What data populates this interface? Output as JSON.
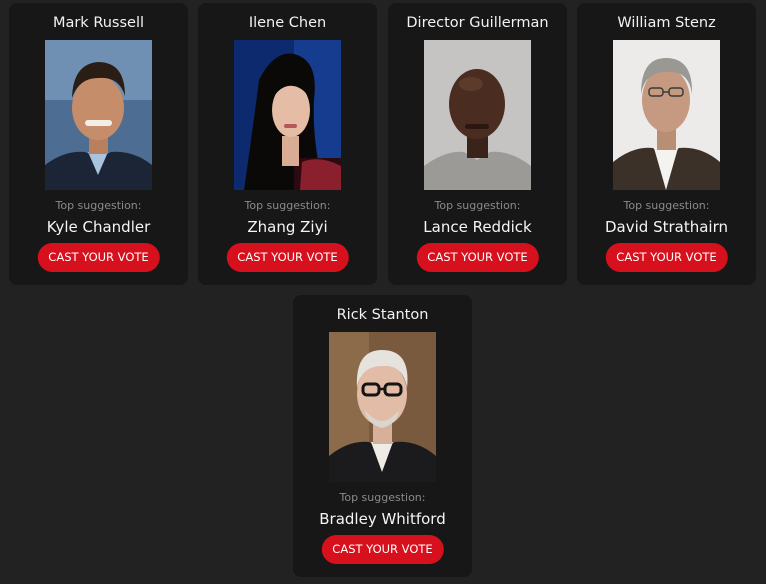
{
  "top_label": "Top suggestion:",
  "vote_label": "CAST YOUR VOTE",
  "cards": [
    {
      "role": "Mark Russell",
      "actor": "Kyle Chandler"
    },
    {
      "role": "Ilene Chen",
      "actor": "Zhang Ziyi"
    },
    {
      "role": "Director Guillerman",
      "actor": "Lance Reddick"
    },
    {
      "role": "William Stenz",
      "actor": "David Strathairn"
    },
    {
      "role": "Rick Stanton",
      "actor": "Bradley Whitford"
    }
  ],
  "colors": {
    "background": "#232222",
    "card": "#181717",
    "vote_button": "#d6101c"
  }
}
